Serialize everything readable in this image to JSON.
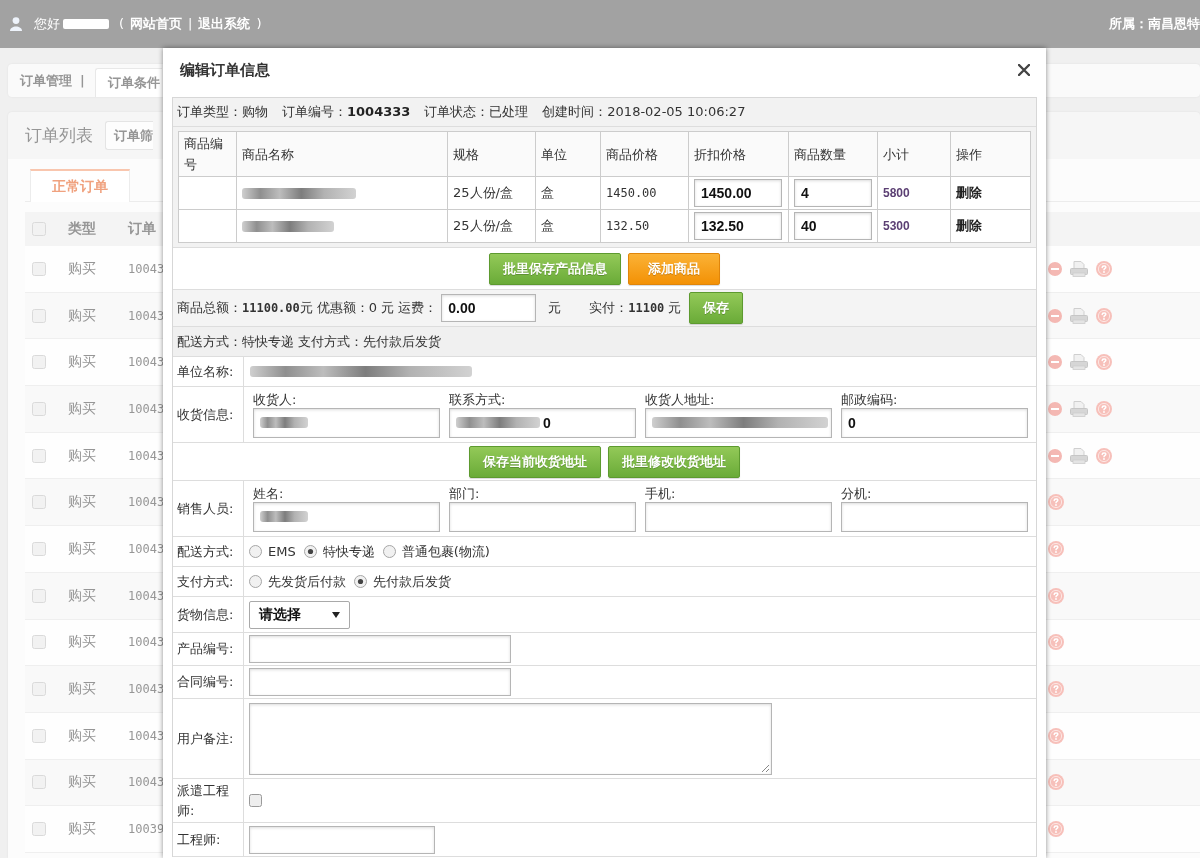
{
  "top_bar": {
    "greeting": "您好",
    "user_name_blurred": true,
    "account_links": {
      "open": "(",
      "links": [
        "网站首页",
        "退出系统"
      ],
      "separator": "|",
      "close": ")"
    },
    "affiliation": "所属：南昌恩特"
  },
  "background_page": {
    "nav": {
      "home": "订单管理",
      "separator": "|",
      "tabs": [
        {
          "label": "订单条件",
          "selected": true
        }
      ]
    },
    "list_title": "订单列表",
    "filter_button": "订单筛",
    "tabs": [
      {
        "label": "正常订单",
        "selected": true
      }
    ],
    "header": {
      "checked": false,
      "columns": [
        "类型",
        "订单"
      ]
    },
    "rows": [
      {
        "checked": false,
        "type": "购买",
        "order_no": "10043",
        "actions": [
          {
            "kind": "remove"
          },
          {
            "kind": "print"
          },
          {
            "kind": "help"
          }
        ]
      },
      {
        "checked": false,
        "type": "购买",
        "order_no": "10043",
        "actions": [
          {
            "kind": "remove"
          },
          {
            "kind": "print"
          },
          {
            "kind": "help"
          }
        ]
      },
      {
        "checked": false,
        "type": "购买",
        "order_no": "10043",
        "actions": [
          {
            "kind": "remove"
          },
          {
            "kind": "print"
          },
          {
            "kind": "help"
          }
        ]
      },
      {
        "checked": false,
        "type": "购买",
        "order_no": "10043",
        "actions": [
          {
            "kind": "remove"
          },
          {
            "kind": "print"
          },
          {
            "kind": "help"
          }
        ]
      },
      {
        "checked": false,
        "type": "购买",
        "order_no": "10043",
        "actions": [
          {
            "kind": "remove"
          },
          {
            "kind": "print"
          },
          {
            "kind": "help"
          }
        ]
      },
      {
        "checked": false,
        "type": "购买",
        "order_no": "10043",
        "actions": [
          {
            "kind": "help"
          }
        ]
      },
      {
        "checked": false,
        "type": "购买",
        "order_no": "10043",
        "actions": [
          {
            "kind": "help"
          }
        ]
      },
      {
        "checked": false,
        "type": "购买",
        "order_no": "10043",
        "actions": [
          {
            "kind": "help"
          }
        ]
      },
      {
        "checked": false,
        "type": "购买",
        "order_no": "10043",
        "actions": [
          {
            "kind": "help"
          }
        ]
      },
      {
        "checked": false,
        "type": "购买",
        "order_no": "10043",
        "actions": [
          {
            "kind": "help"
          }
        ]
      },
      {
        "checked": false,
        "type": "购买",
        "order_no": "10043",
        "actions": [
          {
            "kind": "help"
          }
        ]
      },
      {
        "checked": false,
        "type": "购买",
        "order_no": "10043",
        "actions": [
          {
            "kind": "help"
          }
        ]
      },
      {
        "checked": false,
        "type": "购买",
        "order_no": "10039",
        "actions": [
          {
            "kind": "help"
          }
        ]
      }
    ]
  },
  "dialog": {
    "title": "编辑订单信息",
    "order_info": [
      "订单类型：购物",
      "订单编号：**1004333**",
      "订单状态：已处理",
      "创建时间：2018-02-05 10:06:27"
    ],
    "products": {
      "columns": [
        "商品编号",
        "商品名称",
        "规格",
        "单位",
        "商品价格",
        "折扣价格",
        "商品数量",
        "小计",
        "操作"
      ],
      "rows": [
        {
          "name_blurred": true,
          "spec": "25人份/盒",
          "unit": "盒",
          "price": "1450.00",
          "discount_price": "1450.00",
          "quantity": "4",
          "subtotal": "5800",
          "action": "删除"
        },
        {
          "name_blurred": true,
          "spec": "25人份/盒",
          "unit": "盒",
          "price": "132.50",
          "discount_price": "132.50",
          "quantity": "40",
          "subtotal": "5300",
          "action": "删除"
        }
      ]
    },
    "product_buttons": [
      {
        "label": "批里保存产品信息",
        "kind": "success"
      },
      {
        "label": "添加商品",
        "kind": "warning"
      }
    ],
    "totals": [
      {
        "kind": "text",
        "text": "商品总额：**11100.00**元"
      },
      {
        "kind": "text",
        "text": "优惠额：0 元"
      },
      {
        "kind": "input",
        "label": "运费：",
        "value": "0.00",
        "suffix": "元"
      },
      {
        "kind": "text",
        "text": "实付：**11100** 元"
      },
      {
        "kind": "button",
        "label": "保存"
      }
    ],
    "summary": "配送方式：特快专递 支付方式：先付款后发货",
    "form": [
      {
        "kind": "value",
        "label": "单位名称:",
        "value_blurred": true
      },
      {
        "kind": "fields",
        "label": "收货信息:",
        "fields": [
          {
            "label": "收货人:",
            "value_blurred": true
          },
          {
            "label": "联系方式:",
            "value_blurred": true,
            "value": "0"
          },
          {
            "label": "收货人地址:",
            "value_blurred": true
          },
          {
            "label": "邮政编码:",
            "value_blurred": false,
            "value": "0"
          }
        ]
      },
      {
        "kind": "buttons",
        "buttons": [
          {
            "label": "保存当前收货地址",
            "kind": "success"
          },
          {
            "label": "批里修改收货地址",
            "kind": "success"
          }
        ]
      },
      {
        "kind": "fields",
        "label": "销售人员:",
        "fields": [
          {
            "label": "姓名:",
            "value_blurred": true
          },
          {
            "label": "部门:",
            "value_blurred": false
          },
          {
            "label": "手机:",
            "value_blurred": false
          },
          {
            "label": "分机:",
            "value_blurred": false
          }
        ]
      },
      {
        "kind": "radio",
        "label": "配送方式:",
        "options": [
          {
            "label": "EMS",
            "selected": false
          },
          {
            "label": "特快专递",
            "selected": true
          },
          {
            "label": "普通包裹(物流)",
            "selected": false
          }
        ]
      },
      {
        "kind": "radio",
        "label": "支付方式:",
        "options": [
          {
            "label": "先发货后付款",
            "selected": false
          },
          {
            "label": "先付款后发货",
            "selected": true
          }
        ]
      },
      {
        "kind": "select",
        "label": "货物信息:",
        "value": "请选择"
      },
      {
        "kind": "input",
        "label": "产品编号:"
      },
      {
        "kind": "input",
        "label": "合同编号:"
      },
      {
        "kind": "textarea",
        "label": "用户备注:"
      },
      {
        "kind": "checkbox",
        "label": "派遣工程师:",
        "checked": false
      },
      {
        "kind": "short_input",
        "label": "工程师:"
      }
    ]
  }
}
